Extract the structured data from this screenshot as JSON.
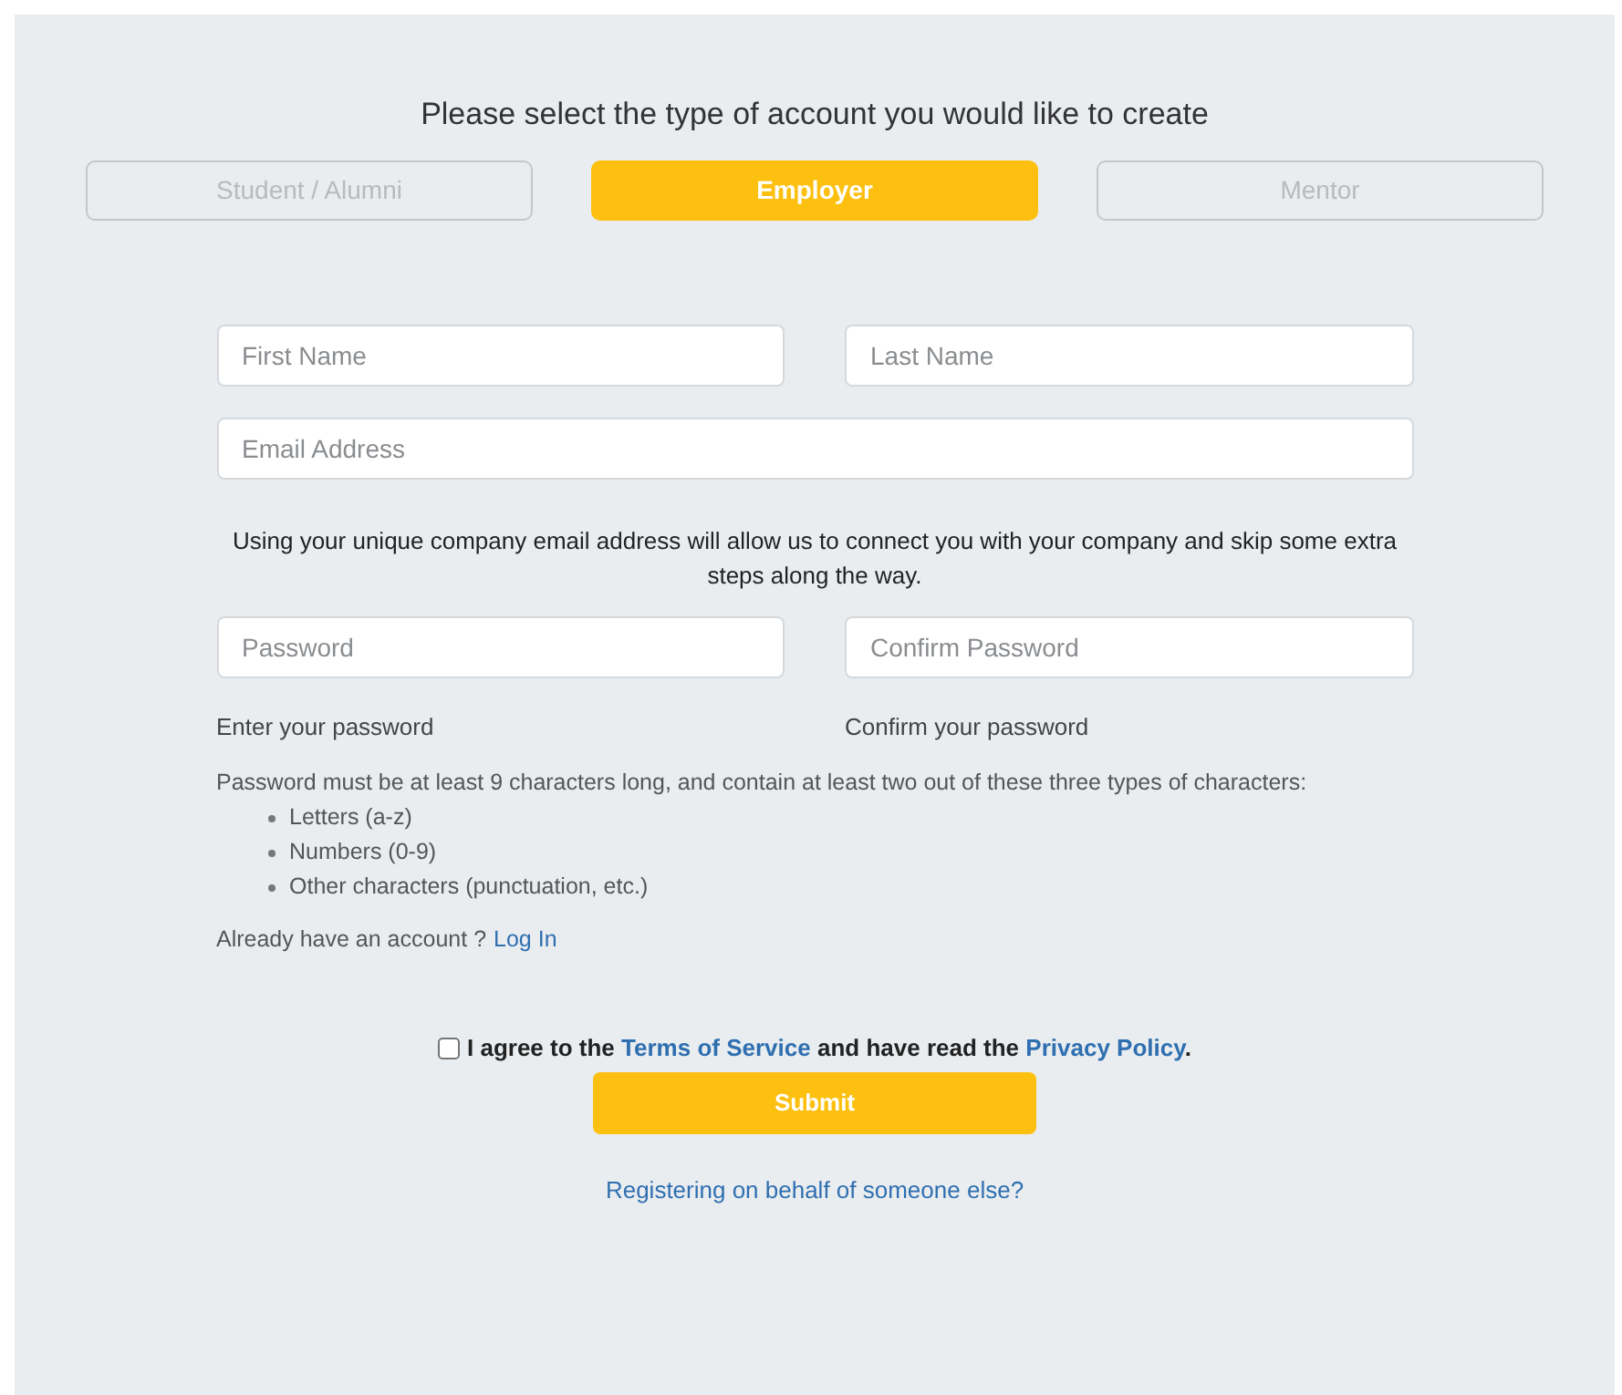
{
  "heading": "Please select the type of account you would like to create",
  "account_types": [
    {
      "label": "Student / Alumni",
      "selected": false
    },
    {
      "label": "Employer",
      "selected": true
    },
    {
      "label": "Mentor",
      "selected": false
    }
  ],
  "name_fields": [
    {
      "placeholder": "First Name"
    },
    {
      "placeholder": "Last Name"
    }
  ],
  "email_field": {
    "placeholder": "Email Address"
  },
  "email_note": "Using your unique company email address will allow us to connect you with your company and skip some extra steps along the way.",
  "password_fields": [
    {
      "placeholder": "Password",
      "hint": "Enter your password"
    },
    {
      "placeholder": "Confirm Password",
      "hint": "Confirm your password"
    }
  ],
  "password_rules": {
    "intro": "Password must be at least 9 characters long, and contain at least two out of these three types of characters:",
    "items": [
      "Letters (a-z)",
      "Numbers (0-9)",
      "Other characters (punctuation, etc.)"
    ]
  },
  "login_prompt": {
    "text": "Already have an account ?",
    "link": "Log In"
  },
  "agreement": {
    "checked": false,
    "before": "I agree to the",
    "terms_link": "Terms of Service",
    "middle": "and have read the",
    "privacy_link": "Privacy Policy",
    "after": "."
  },
  "submit_button": "Submit",
  "behalf_link": "Registering on behalf of someone else?"
}
